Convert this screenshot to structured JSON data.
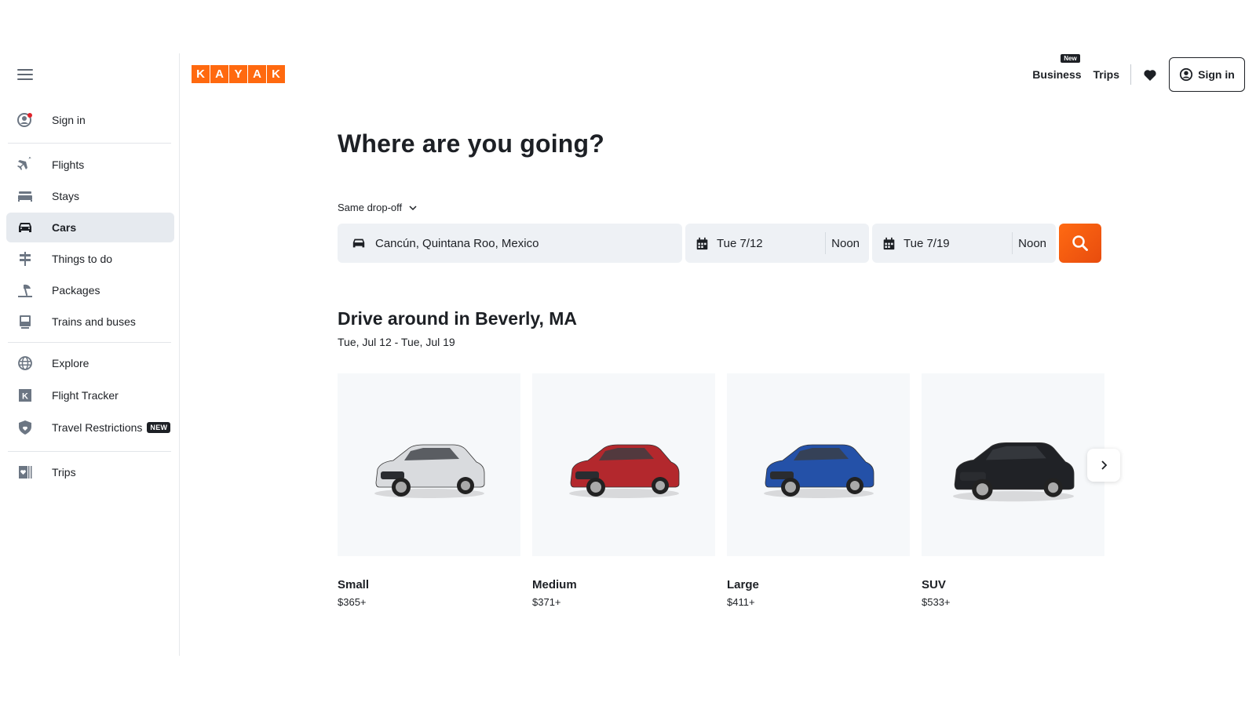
{
  "brand": {
    "logo_letters": [
      "K",
      "A",
      "Y",
      "A",
      "K"
    ],
    "accent": "#ff690f"
  },
  "sidebar": {
    "signin_label": "Sign in",
    "items": [
      {
        "label": "Flights",
        "icon": "plane-icon"
      },
      {
        "label": "Stays",
        "icon": "bed-icon"
      },
      {
        "label": "Cars",
        "icon": "car-icon",
        "active": true
      },
      {
        "label": "Things to do",
        "icon": "signpost-icon"
      },
      {
        "label": "Packages",
        "icon": "beach-umbrella-icon"
      },
      {
        "label": "Trains and buses",
        "icon": "train-icon"
      }
    ],
    "secondary": [
      {
        "label": "Explore",
        "icon": "globe-icon"
      },
      {
        "label": "Flight Tracker",
        "icon": "k-tracker-icon"
      },
      {
        "label": "Travel Restrictions",
        "icon": "shield-icon",
        "badge": "NEW"
      }
    ],
    "trips_label": "Trips"
  },
  "topnav": {
    "business_label": "Business",
    "business_badge": "New",
    "trips_label": "Trips",
    "signin_label": "Sign in"
  },
  "main": {
    "title": "Where are you going?",
    "dropoff_label": "Same drop-off",
    "search": {
      "location": "Cancún, Quintana Roo, Mexico",
      "pickup_date": "Tue 7/12",
      "pickup_time": "Noon",
      "dropoff_date": "Tue 7/19",
      "dropoff_time": "Noon"
    },
    "section_title": "Drive around in Beverly, MA",
    "section_dates": "Tue, Jul 12 - Tue, Jul 19",
    "cars": [
      {
        "name": "Small",
        "price": "$365+",
        "color": "#d9dbde"
      },
      {
        "name": "Medium",
        "price": "$371+",
        "color": "#b3282d"
      },
      {
        "name": "Large",
        "price": "$411+",
        "color": "#2451a8"
      },
      {
        "name": "SUV",
        "price": "$533+",
        "color": "#202226"
      }
    ]
  }
}
